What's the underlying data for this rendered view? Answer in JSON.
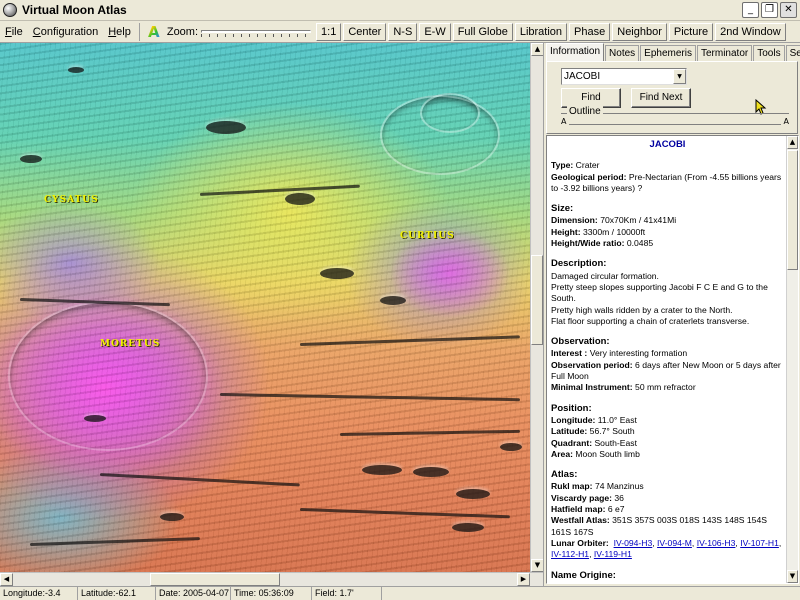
{
  "window": {
    "title": "Virtual Moon Atlas",
    "controls": [
      "_",
      "❐",
      "✕"
    ]
  },
  "menu": {
    "items": [
      {
        "label": "File",
        "key": "F",
        "rest": "ile"
      },
      {
        "label": "Configuration",
        "key": "C",
        "rest": "onfiguration"
      },
      {
        "label": "Help",
        "key": "H",
        "rest": "elp"
      }
    ]
  },
  "toolbar": {
    "color_icon": "A",
    "zoom_label": "Zoom:",
    "buttons": [
      "1:1",
      "Center",
      "N-S",
      "E-W",
      "Full Globe",
      "Libration",
      "Phase",
      "Neighbor",
      "Picture",
      "2nd Window"
    ]
  },
  "map": {
    "labels": {
      "cysatus": "CYSATUS",
      "curtius": "CURTIUS",
      "moretus": "MORETUS"
    }
  },
  "panel": {
    "tabs": [
      "Information",
      "Notes",
      "Ephemeris",
      "Terminator",
      "Tools",
      "Setup"
    ],
    "active_tab": "Information",
    "search_value": "JACOBI",
    "find_button": "Find",
    "find_next_button": "Find Next",
    "outline_label": "Outline",
    "outline_marker": "A"
  },
  "info": {
    "title": "JACOBI",
    "type_label": "Type:",
    "type_value": "Crater",
    "geo_label": "Geological period:",
    "geo_value": "Pre-Nectarian (From -4.55 billions years to -3.92 billions years) ?",
    "size": {
      "heading": "Size:",
      "dimension_label": "Dimension:",
      "dimension_value": "70x70Km / 41x41Mi",
      "height_label": "Height:",
      "height_value": "3300m / 10000ft",
      "ratio_label": "Height/Wide ratio:",
      "ratio_value": "0.0485"
    },
    "description": {
      "heading": "Description:",
      "lines": [
        "Damaged circular formation.",
        "Pretty steep slopes supporting Jacobi F C E and G to the South.",
        "Pretty high walls ridden by a crater to the North.",
        "Flat floor supporting a chain of craterlets transverse."
      ]
    },
    "observation": {
      "heading": "Observation:",
      "interest_label": "Interest :",
      "interest_value": "Very interesting formation",
      "period_label": "Observation period:",
      "period_value": "6 days after New Moon or 5 days after Full Moon",
      "instrument_label": "Minimal Instrument:",
      "instrument_value": "50 mm refractor"
    },
    "position": {
      "heading": "Position:",
      "longitude_label": "Longitude:",
      "longitude_value": "11.0° East",
      "latitude_label": "Latitude:",
      "latitude_value": "56.7° South",
      "quadrant_label": "Quadrant:",
      "quadrant_value": "South-East",
      "area_label": "Area:",
      "area_value": "Moon South limb"
    },
    "atlas": {
      "heading": "Atlas:",
      "rukl_label": "Rukl map:",
      "rukl_value": "74 Manzinus",
      "viscardy_label": "Viscardy page:",
      "viscardy_value": "36",
      "hatfield_label": "Hatfield map:",
      "hatfield_value": "6 e7",
      "westfall_label": "Westfall Atlas:",
      "westfall_value": "351S 357S 003S 018S 143S 148S 154S 161S 167S",
      "orbiter_label": "Lunar Orbiter:",
      "orbiter_links": [
        "IV-094-H3",
        "IV-094-M",
        "IV-106-H3",
        "IV-107-H1",
        "IV-112-H1",
        "IV-119-H1"
      ]
    },
    "name_origin_heading": "Name Origine:"
  },
  "status": {
    "longitude": "Longitude:-3.4",
    "latitude": "Latitude:-62.1",
    "date": "Date: 2005-04-07",
    "time": "Time: 05:36:09",
    "field": "Field: 1.7'"
  }
}
